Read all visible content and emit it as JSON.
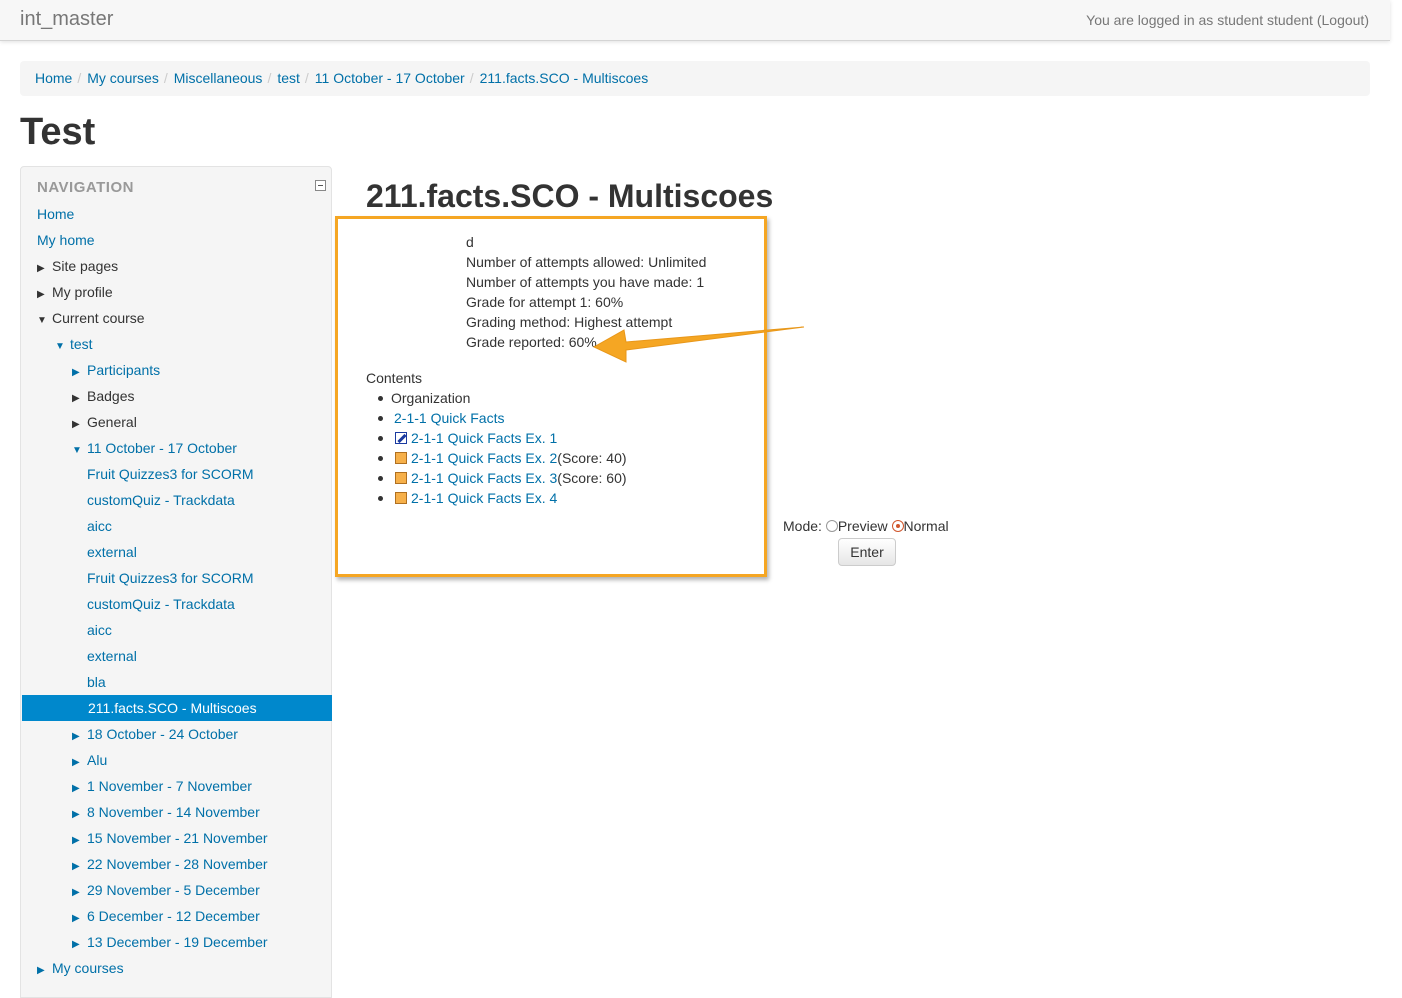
{
  "header": {
    "brand": "int_master",
    "login_prefix": "You are logged in as ",
    "user": "student student",
    "logout_open": " (",
    "logout": "Logout",
    "logout_close": ")"
  },
  "breadcrumb": [
    "Home",
    "My courses",
    "Miscellaneous",
    "test",
    "11 October - 17 October",
    "211.facts.SCO - Multiscoes"
  ],
  "breadcrumb_separator": "/",
  "page_title": "Test",
  "navigation": {
    "heading": "NAVIGATION",
    "items": [
      {
        "label": "Home"
      },
      {
        "label": "My home"
      },
      {
        "label": "Site pages"
      },
      {
        "label": "My profile"
      },
      {
        "label": "Current course"
      },
      {
        "label": "test"
      },
      {
        "label": "Participants"
      },
      {
        "label": "Badges"
      },
      {
        "label": "General"
      },
      {
        "label": "11 October - 17 October"
      },
      {
        "label": "Fruit Quizzes3 for SCORM"
      },
      {
        "label": "customQuiz - Trackdata"
      },
      {
        "label": "aicc"
      },
      {
        "label": "external"
      },
      {
        "label": "Fruit Quizzes3 for SCORM"
      },
      {
        "label": "customQuiz - Trackdata"
      },
      {
        "label": "aicc"
      },
      {
        "label": "external"
      },
      {
        "label": "bla"
      },
      {
        "label": "211.facts.SCO - Multiscoes"
      },
      {
        "label": "18 October - 24 October"
      },
      {
        "label": "Alu"
      },
      {
        "label": "1 November - 7 November"
      },
      {
        "label": "8 November - 14 November"
      },
      {
        "label": "15 November - 21 November"
      },
      {
        "label": "22 November - 28 November"
      },
      {
        "label": "29 November - 5 December"
      },
      {
        "label": "6 December - 12 December"
      },
      {
        "label": "13 December - 19 December"
      },
      {
        "label": "My courses"
      }
    ]
  },
  "activity": {
    "title": "211.facts.SCO - Multiscoes",
    "info": [
      "d",
      "Number of attempts allowed: Unlimited",
      "Number of attempts you have made: 1",
      "Grade for attempt 1: 60%",
      "Grading method: Highest attempt",
      "Grade reported: 60%"
    ],
    "contents_label": "Contents",
    "organization": "Organization",
    "toc": [
      {
        "label": "2-1-1 Quick Facts",
        "score": ""
      },
      {
        "label": "2-1-1 Quick Facts Ex. 1",
        "score": ""
      },
      {
        "label": "2-1-1 Quick Facts Ex. 2",
        "score": "(Score: 40)"
      },
      {
        "label": "2-1-1 Quick Facts Ex. 3",
        "score": "(Score: 60)"
      },
      {
        "label": "2-1-1 Quick Facts Ex. 4",
        "score": ""
      }
    ],
    "mode_label": "Mode:",
    "mode_options": [
      "Preview",
      "Normal"
    ],
    "mode_selected": "Normal",
    "enter_label": "Enter"
  },
  "colors": {
    "link": "#0070a8",
    "active_bg": "#0088cc",
    "highlight_border": "#f5a623"
  }
}
